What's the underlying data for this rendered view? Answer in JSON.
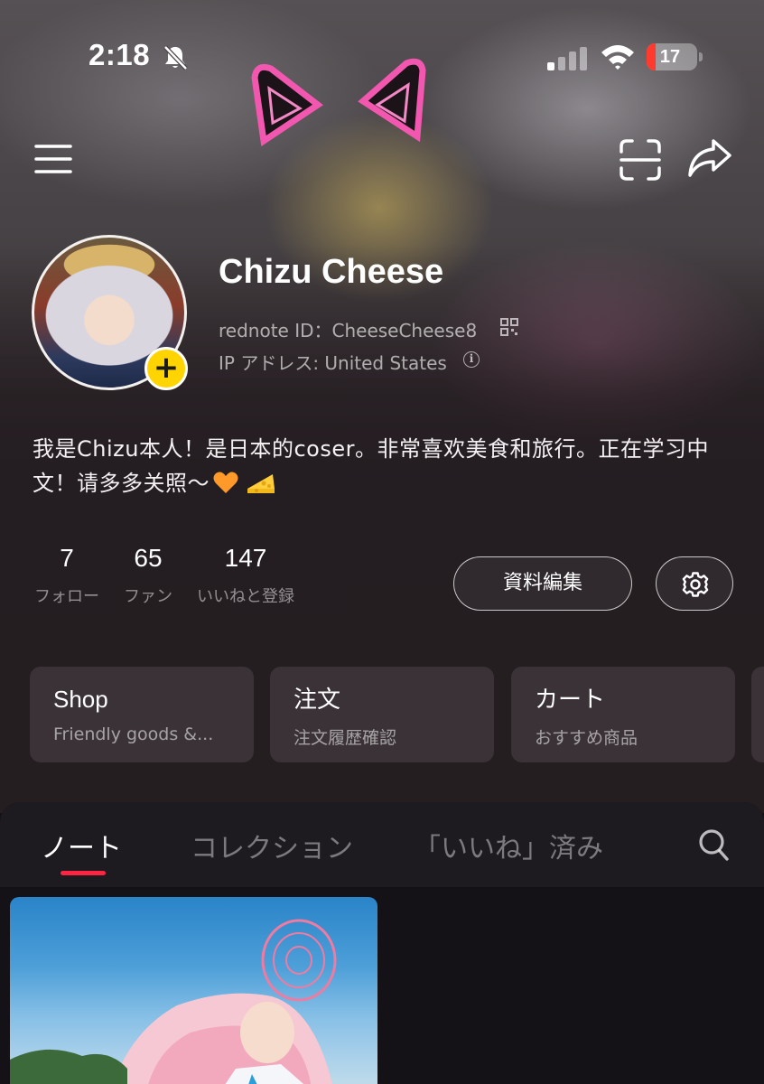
{
  "status_bar": {
    "time": "2:18",
    "battery_level": "17",
    "battery_fraction": 0.17,
    "icons": [
      "bell-slash-icon",
      "cellular-signal-icon",
      "wifi-icon",
      "battery-icon"
    ]
  },
  "nav": {
    "icons": [
      "menu-icon",
      "scan-icon",
      "share-icon"
    ]
  },
  "profile": {
    "name": "Chizu Cheese",
    "rednote_id": "rednote ID：CheeseCheese8",
    "ip_location": "IP アドレス: United States",
    "bio": "我是Chizu本人！是日本的coser。非常喜欢美食和旅行。正在学习中文！请多多关照〜",
    "avatar_add_symbol": "+"
  },
  "stats": [
    {
      "value": "7",
      "label": "フォロー"
    },
    {
      "value": "65",
      "label": "ファン"
    },
    {
      "value": "147",
      "label": "いいねと登録"
    }
  ],
  "actions": {
    "edit_profile_label": "資料編集",
    "settings_icon": "gear-icon"
  },
  "quick_cards": [
    {
      "title": "Shop",
      "subtitle": "Friendly goods &..."
    },
    {
      "title": "注文",
      "subtitle": "注文履歴確認"
    },
    {
      "title": "カート",
      "subtitle": "おすすめ商品"
    }
  ],
  "tabs": [
    {
      "label": "ノート",
      "active": true
    },
    {
      "label": "コレクション",
      "active": false
    },
    {
      "label": "「いいね」済み",
      "active": false
    }
  ],
  "colors": {
    "accent_red": "#ff2442",
    "avatar_badge_yellow": "#ffd400",
    "background": "#141217",
    "card_bg": "#3a3236"
  }
}
